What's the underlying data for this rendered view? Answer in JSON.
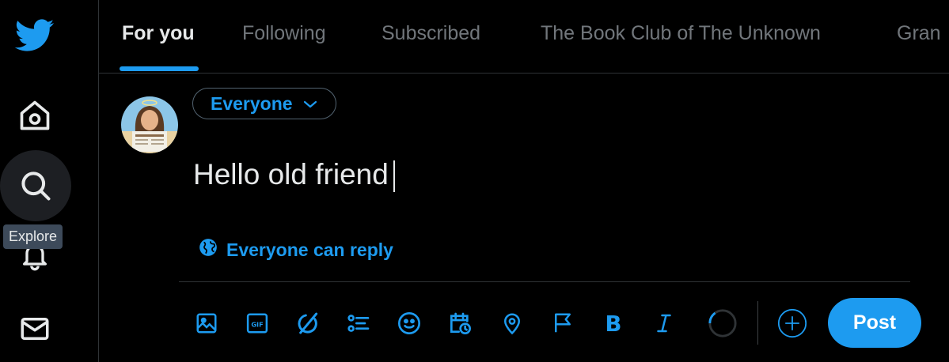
{
  "tabs": [
    {
      "label": "For you",
      "active": true
    },
    {
      "label": "Following",
      "active": false
    },
    {
      "label": "Subscribed",
      "active": false
    },
    {
      "label": "The Book Club of The Unknown",
      "active": false
    },
    {
      "label": "Gran",
      "active": false
    }
  ],
  "sidebar": {
    "items": [
      "twitter-logo-icon",
      "home-icon",
      "search-icon",
      "bell-icon",
      "mail-icon"
    ],
    "tooltip": "Explore"
  },
  "composer": {
    "audience": "Everyone",
    "text": "Hello old friend",
    "reply_setting": "Everyone can reply"
  },
  "toolbar": {
    "icons": [
      "image-icon",
      "gif-icon",
      "grok-icon",
      "poll-icon",
      "emoji-icon",
      "schedule-icon",
      "location-icon",
      "flag-icon",
      "bold-icon",
      "italic-icon",
      "char-counter-icon",
      "add-post-icon"
    ],
    "post_label": "Post"
  },
  "colors": {
    "accent": "#1d9bf0",
    "background": "#000000",
    "muted": "#71767b",
    "text": "#e7e9ea"
  }
}
